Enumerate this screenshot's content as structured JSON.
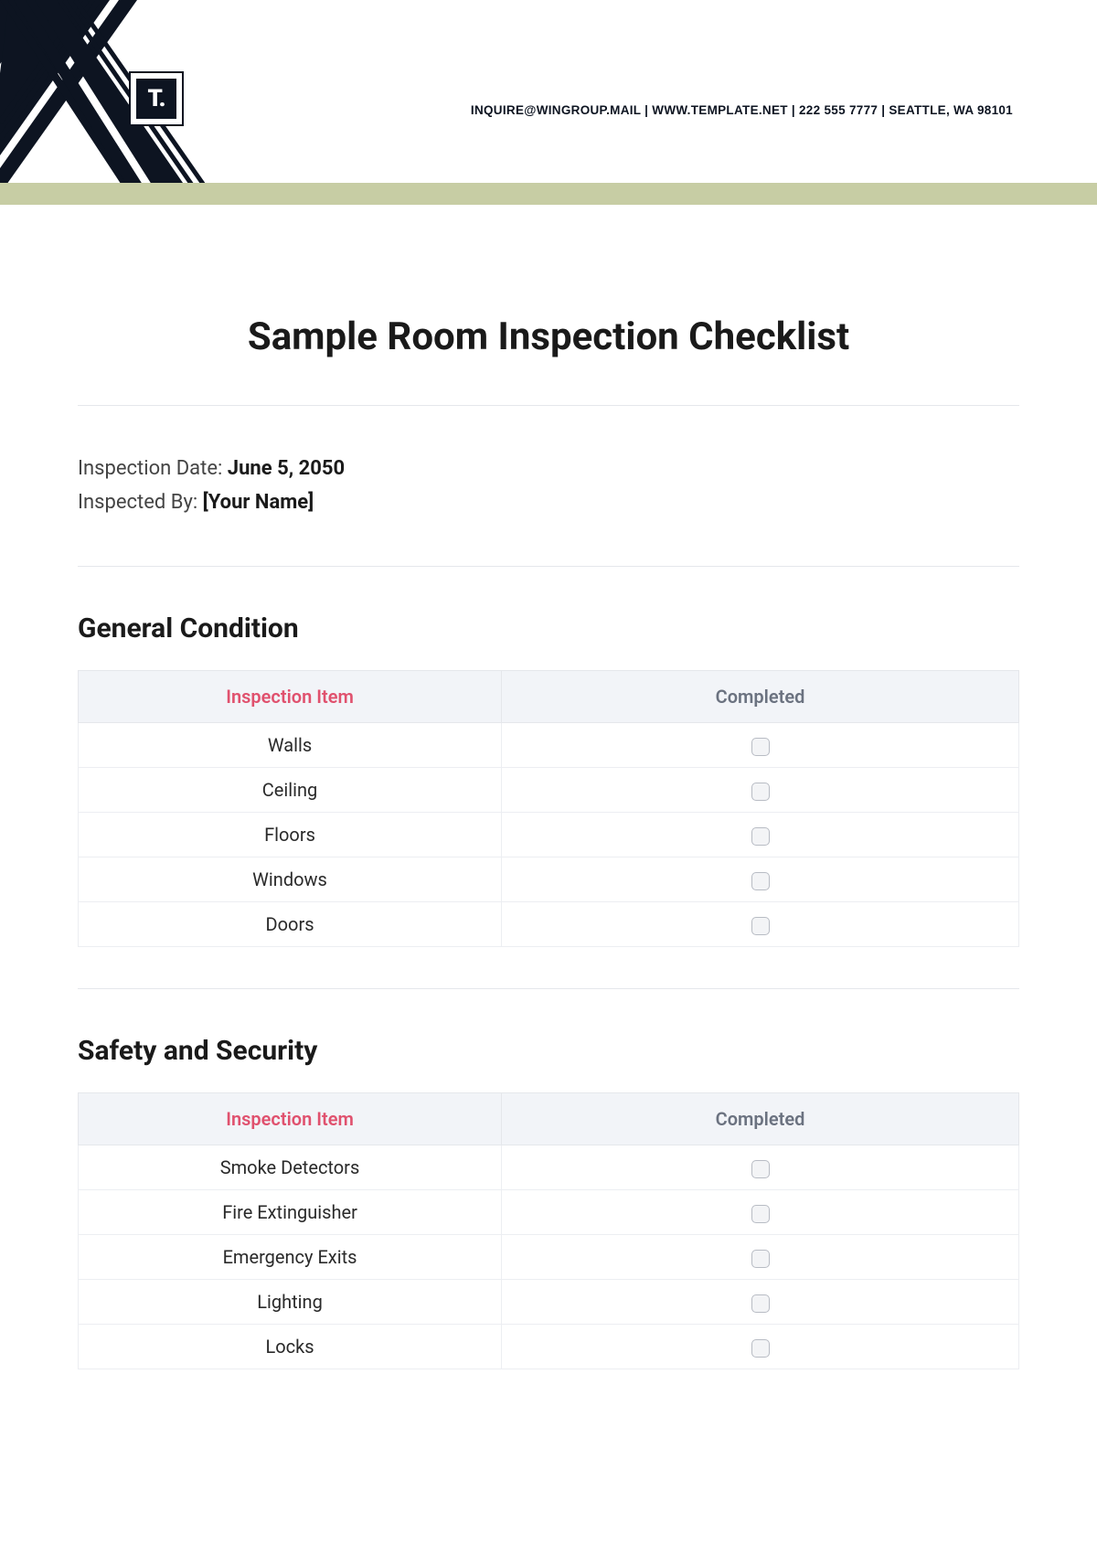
{
  "header": {
    "logo_text": "T.",
    "contact": "INQUIRE@WINGROUP.MAIL  |  WWW.TEMPLATE.NET  |  222 555 7777 | SEATTLE, WA 98101"
  },
  "title": "Sample Room Inspection Checklist",
  "meta": {
    "inspection_date_label": "Inspection Date: ",
    "inspection_date_value": "June 5, 2050",
    "inspected_by_label": "Inspected By: ",
    "inspected_by_value": "[Your Name]"
  },
  "table_headers": {
    "item": "Inspection Item",
    "completed": "Completed"
  },
  "sections": [
    {
      "heading": "General Condition",
      "items": [
        "Walls",
        "Ceiling",
        "Floors",
        "Windows",
        "Doors"
      ]
    },
    {
      "heading": "Safety and Security",
      "items": [
        "Smoke Detectors",
        "Fire Extinguisher",
        "Emergency Exits",
        "Lighting",
        "Locks"
      ]
    }
  ]
}
